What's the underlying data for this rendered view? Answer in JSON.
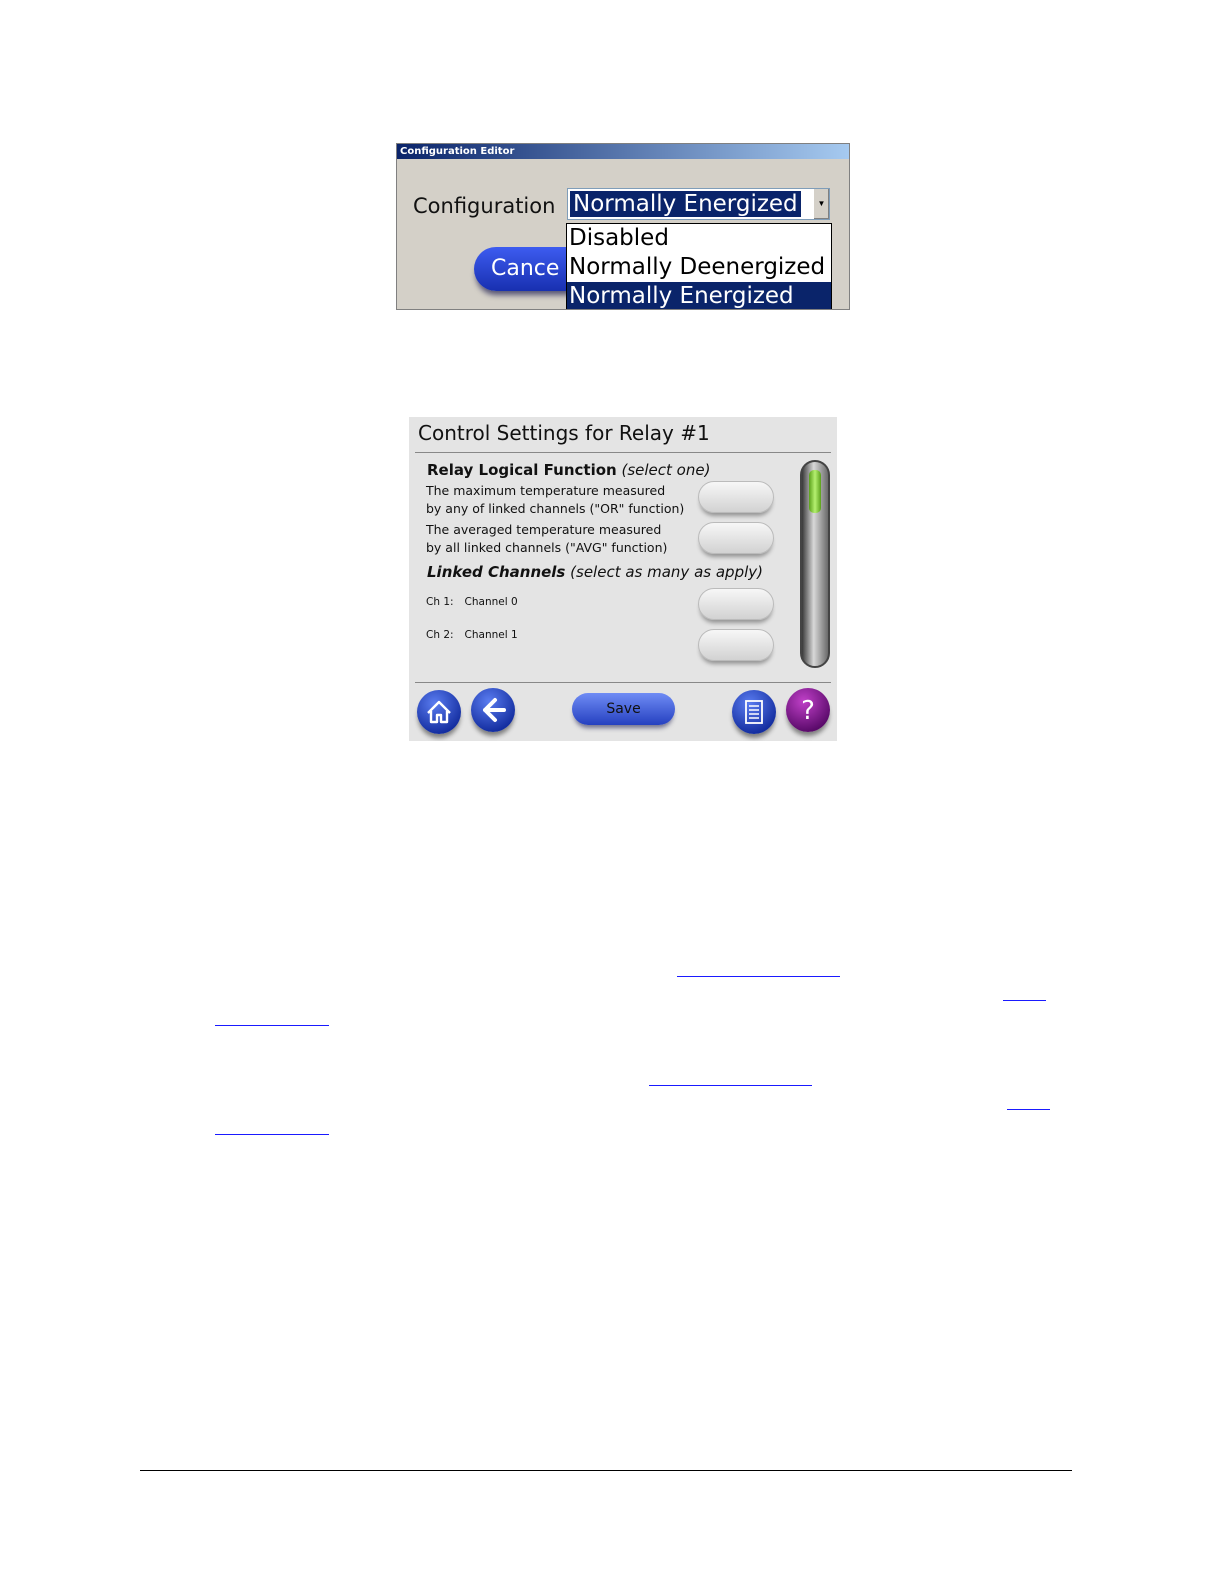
{
  "config_editor": {
    "title": "Configuration Editor",
    "label": "Configuration",
    "selected": "Normally Energized",
    "cancel_label": "Cance",
    "options": [
      "Disabled",
      "Normally Deenergized",
      "Normally Energized"
    ]
  },
  "control_settings": {
    "title": "Control Settings for Relay #1",
    "logical_function": {
      "heading": "Relay Logical Function",
      "hint": "(select one)",
      "options": [
        {
          "line1": "The maximum temperature measured",
          "line2": "by any of linked channels (\"OR\" function)"
        },
        {
          "line1": "The averaged temperature measured",
          "line2": "by all  linked channels (\"AVG\" function)"
        }
      ]
    },
    "linked_channels": {
      "heading": "Linked Channels",
      "hint": "(select as many as apply)",
      "channels": [
        {
          "id": "Ch 1:",
          "name": "Channel 0"
        },
        {
          "id": "Ch 2:",
          "name": "Channel 1"
        }
      ]
    },
    "scroll_position": 0,
    "save_label": "Save",
    "icons": {
      "home": "home-icon",
      "back": "arrow-left-icon",
      "list": "document-list-icon",
      "help": "question-mark-icon"
    }
  },
  "colors": {
    "selection_blue": "#0a246a",
    "dialog_gray": "#d4d0c8",
    "panel_gray": "#e4e4e4",
    "link_blue": "#1a1aff"
  }
}
